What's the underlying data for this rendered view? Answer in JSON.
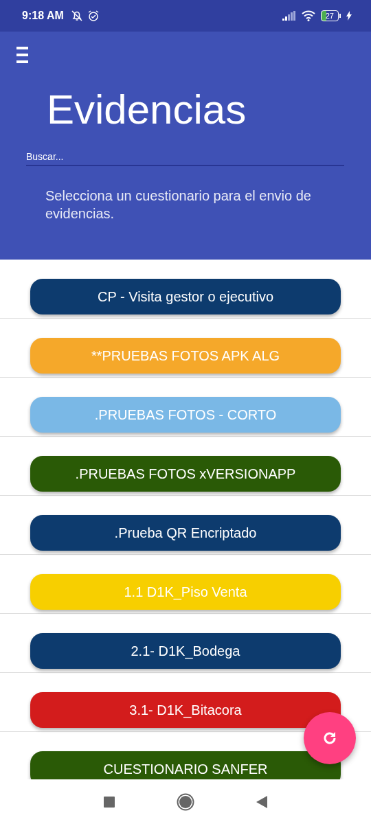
{
  "status_bar": {
    "time": "9:18 AM",
    "battery": "27"
  },
  "header": {
    "title": "Evidencias",
    "search": {
      "placeholder": "Buscar..."
    },
    "instructions": "Selecciona un cuestionario para el envio de evidencias."
  },
  "questionnaires": [
    {
      "label": "CP - Visita gestor o ejecutivo",
      "color": "#0d3b6e"
    },
    {
      "label": "**PRUEBAS FOTOS APK ALG",
      "color": "#f5a82a"
    },
    {
      "label": ".PRUEBAS FOTOS - CORTO",
      "color": "#7ab8e6"
    },
    {
      "label": ".PRUEBAS FOTOS xVERSIONAPP",
      "color": "#2a5a06"
    },
    {
      "label": ".Prueba QR Encriptado",
      "color": "#0d3b6e"
    },
    {
      "label": "1.1 D1K_Piso Venta",
      "color": "#f7cf00"
    },
    {
      "label": "2.1- D1K_Bodega",
      "color": "#0d3b6e"
    },
    {
      "label": "3.1- D1K_Bitacora",
      "color": "#d31c1c"
    },
    {
      "label": "CUESTIONARIO SANFER",
      "color": "#2a5a06"
    }
  ]
}
